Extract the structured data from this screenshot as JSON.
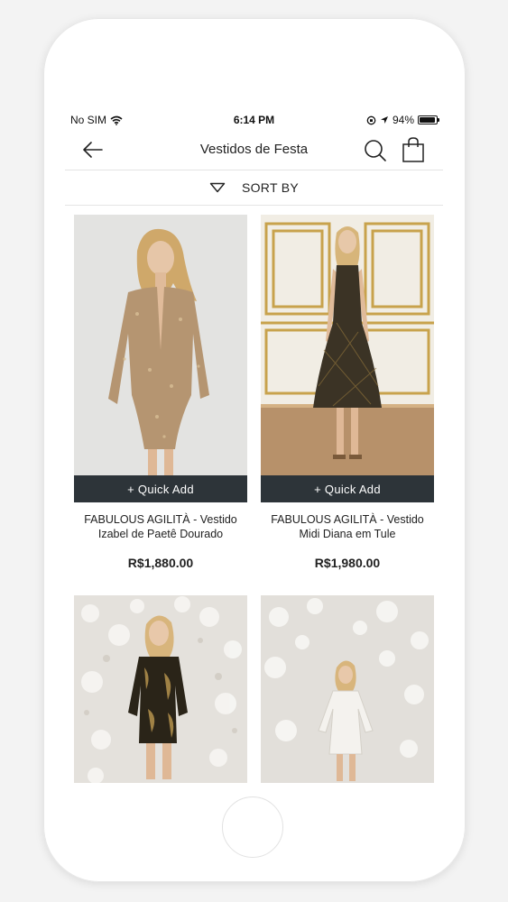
{
  "status_bar": {
    "carrier": "No SIM",
    "time": "6:14 PM",
    "battery": "94%",
    "battery_level": 0.94
  },
  "nav": {
    "title": "Vestidos de Festa"
  },
  "sort": {
    "label": "SORT BY"
  },
  "products": [
    {
      "name": "FABULOUS AGILITÀ - Vestido Izabel de Paetê Dourado",
      "price": "R$1,880.00",
      "quick_add": "+ Quick Add",
      "dress_color": "#b59571"
    },
    {
      "name": "FABULOUS AGILITÀ - Vestido Midi Diana em Tule",
      "price": "R$1,980.00",
      "quick_add": "+ Quick Add",
      "dress_color": "#3b3325"
    },
    {
      "name": "",
      "price": "",
      "quick_add": "",
      "dress_color": "#2a2418"
    },
    {
      "name": "",
      "price": "",
      "quick_add": "",
      "dress_color": "#f4f2ee"
    }
  ],
  "colors": {
    "quick_add_bg": "#2d3439",
    "text": "#222222"
  }
}
